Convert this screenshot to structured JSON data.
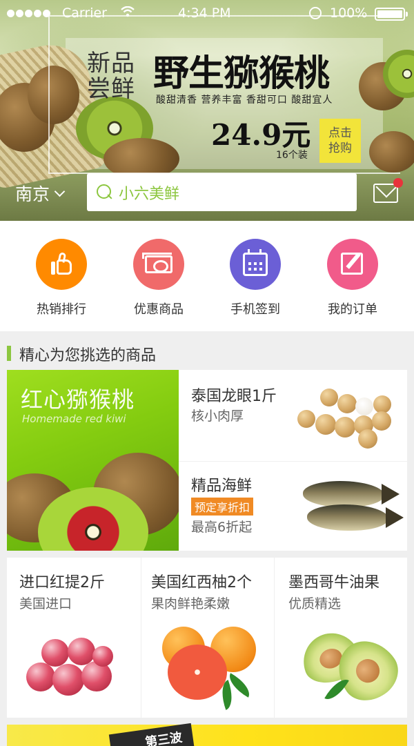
{
  "status_bar": {
    "carrier": "Carrier",
    "time": "4:34 PM",
    "battery": "100%"
  },
  "banner": {
    "new_tag": "新品尝鲜",
    "title": "野生猕猴桃",
    "subtitle": "酸甜清香 营养丰富 香甜可口 酸甜宜人",
    "price": "24.9元",
    "count": "16个装",
    "buy_label": "点击抢购"
  },
  "header": {
    "city": "南京",
    "search_placeholder": "小六美鲜"
  },
  "quick_menu": [
    {
      "label": "热销排行",
      "icon": "thumbs-up-icon",
      "color": "#ff8a00"
    },
    {
      "label": "优惠商品",
      "icon": "coupon-icon",
      "color": "#f06a6a"
    },
    {
      "label": "手机签到",
      "icon": "calendar-icon",
      "color": "#6b5fd6"
    },
    {
      "label": "我的订单",
      "icon": "edit-icon",
      "color": "#f15b8a"
    }
  ],
  "section": {
    "title": "精心为您挑选的商品"
  },
  "featured": {
    "kiwi_title": "红心猕猴桃",
    "kiwi_subtitle": "Homemade red kiwi"
  },
  "products_right": [
    {
      "title": "泰国龙眼1斤",
      "subtitle": "核小肉厚"
    },
    {
      "title": "精品海鲜",
      "tag": "预定享折扣",
      "subtitle": "最高6折起"
    }
  ],
  "products_row": [
    {
      "title": "进口红提2斤",
      "subtitle": "美国进口"
    },
    {
      "title": "美国红西柚2个",
      "subtitle": "果肉鲜艳柔嫩"
    },
    {
      "title": "墨西哥牛油果",
      "subtitle": "优质精选"
    }
  ],
  "promo": {
    "text": "第三波"
  },
  "colors": {
    "accent_green": "#8cc63f",
    "tag_orange": "#f08a24",
    "notify_red": "#e8333b"
  }
}
